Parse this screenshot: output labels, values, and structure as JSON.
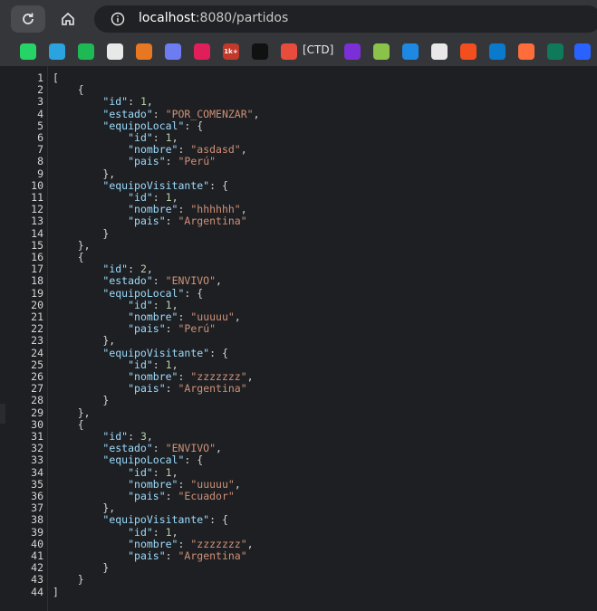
{
  "browser": {
    "url_host": "localhost",
    "url_rest": ":8080/partidos",
    "icons": {
      "reload": "reload-icon",
      "home": "home-icon",
      "info": "info-icon"
    }
  },
  "bookmarks": {
    "items": [
      {
        "name": "whatsapp-icon",
        "color": "#25d366",
        "glyph": ""
      },
      {
        "name": "telegram-icon",
        "color": "#2aa3df",
        "glyph": ""
      },
      {
        "name": "spotify-icon",
        "color": "#1db954",
        "glyph": ""
      },
      {
        "name": "openai-icon",
        "color": "#e8e8e8",
        "glyph": ""
      },
      {
        "name": "m-logo-icon",
        "color": "#e87722",
        "glyph": ""
      },
      {
        "name": "sparkle-icon",
        "color": "#6e7cf2",
        "glyph": ""
      },
      {
        "name": "slack-icon",
        "color": "#e01e5a",
        "glyph": ""
      },
      {
        "name": "counter-badge-icon",
        "color": "#c0392b",
        "glyph": "1k+"
      },
      {
        "name": "dark-box-icon",
        "color": "#111111",
        "glyph": ""
      },
      {
        "name": "heart-icon",
        "color": "#e74c3c",
        "glyph": ""
      },
      {
        "name": "shield-u-icon",
        "color": "#7b2fd6",
        "glyph": ""
      },
      {
        "name": "diamond-icon",
        "color": "#8bc34a",
        "glyph": ""
      },
      {
        "name": "square-app-icon",
        "color": "#1e88e5",
        "glyph": ""
      },
      {
        "name": "github-icon",
        "color": "#e8e8e8",
        "glyph": ""
      },
      {
        "name": "figma-icon",
        "color": "#f24e1e",
        "glyph": ""
      },
      {
        "name": "vscode-icon",
        "color": "#0a7acc",
        "glyph": ""
      },
      {
        "name": "orange-arrow-icon",
        "color": "#ff6d3a",
        "glyph": ""
      },
      {
        "name": "leaf-icon",
        "color": "#0f7a5a",
        "glyph": ""
      },
      {
        "name": "r-logo-icon",
        "color": "#2962ff",
        "glyph": ""
      }
    ],
    "ctd_label": "[CTD]"
  },
  "code_lines": [
    "[",
    "    {",
    "        \"id\": 1,",
    "        \"estado\": \"POR_COMENZAR\",",
    "        \"equipoLocal\": {",
    "            \"id\": 1,",
    "            \"nombre\": \"asdasd\",",
    "            \"pais\": \"Perú\"",
    "        },",
    "        \"equipoVisitante\": {",
    "            \"id\": 1,",
    "            \"nombre\": \"hhhhhh\",",
    "            \"pais\": \"Argentina\"",
    "        }",
    "    },",
    "    {",
    "        \"id\": 2,",
    "        \"estado\": \"ENVIVO\",",
    "        \"equipoLocal\": {",
    "            \"id\": 1,",
    "            \"nombre\": \"uuuuu\",",
    "            \"pais\": \"Perú\"",
    "        },",
    "        \"equipoVisitante\": {",
    "            \"id\": 1,",
    "            \"nombre\": \"zzzzzzz\",",
    "            \"pais\": \"Argentina\"",
    "        }",
    "    },",
    "    {",
    "        \"id\": 3,",
    "        \"estado\": \"ENVIVO\",",
    "        \"equipoLocal\": {",
    "            \"id\": 1,",
    "            \"nombre\": \"uuuuu\",",
    "            \"pais\": \"Ecuador\"",
    "        },",
    "        \"equipoVisitante\": {",
    "            \"id\": 1,",
    "            \"nombre\": \"zzzzzzz\",",
    "            \"pais\": \"Argentina\"",
    "        }",
    "    }",
    "]"
  ]
}
